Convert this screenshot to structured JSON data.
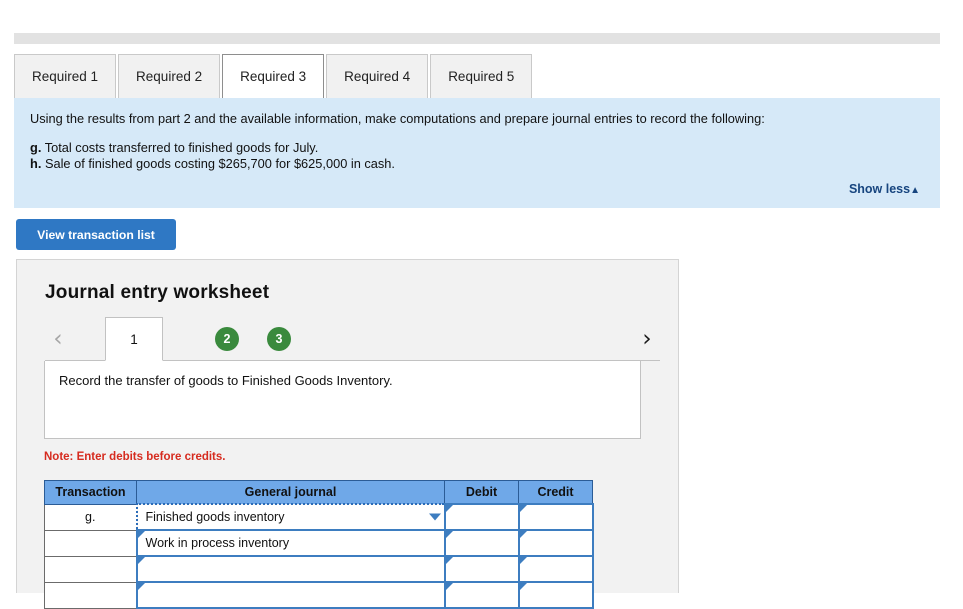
{
  "tabs": [
    {
      "label": "Required 1",
      "active": false
    },
    {
      "label": "Required 2",
      "active": false
    },
    {
      "label": "Required 3",
      "active": true
    },
    {
      "label": "Required 4",
      "active": false
    },
    {
      "label": "Required 5",
      "active": false
    }
  ],
  "info": {
    "intro": "Using the results from part 2 and the available information, make computations and prepare journal entries to record the following:",
    "items": [
      {
        "marker": "g.",
        "text": "Total costs transferred to finished goods for July."
      },
      {
        "marker": "h.",
        "text": "Sale of finished goods costing $265,700 for $625,000 in cash."
      }
    ],
    "show_less_label": "Show less",
    "show_less_caret": "▲",
    "background_color": "#d6e9f8"
  },
  "toolbar": {
    "view_transaction_list_label": "View transaction list",
    "button_color": "#2f78c4"
  },
  "worksheet": {
    "title": "Journal entry worksheet",
    "pager": {
      "prev_icon": "‹",
      "next_icon": "›",
      "current_page": "1",
      "pages": [
        "2",
        "3"
      ],
      "dot_color": "#3a8a3d"
    },
    "instruction": "Record the transfer of goods to Finished Goods Inventory.",
    "note": "Note: Enter debits before credits.",
    "note_color": "#d62b1f",
    "table": {
      "header_color": "#6fa8e8",
      "columns": [
        "Transaction",
        "General journal",
        "Debit",
        "Credit"
      ],
      "rows": [
        {
          "transaction": "g.",
          "account": "Finished goods inventory",
          "debit": "",
          "credit": "",
          "selected": true,
          "dropdown": true
        },
        {
          "transaction": "",
          "account": "Work in process inventory",
          "debit": "",
          "credit": "",
          "selected": false,
          "dropdown": false
        },
        {
          "transaction": "",
          "account": "",
          "debit": "",
          "credit": "",
          "selected": false,
          "dropdown": false
        },
        {
          "transaction": "",
          "account": "",
          "debit": "",
          "credit": "",
          "selected": false,
          "dropdown": false
        }
      ]
    }
  }
}
